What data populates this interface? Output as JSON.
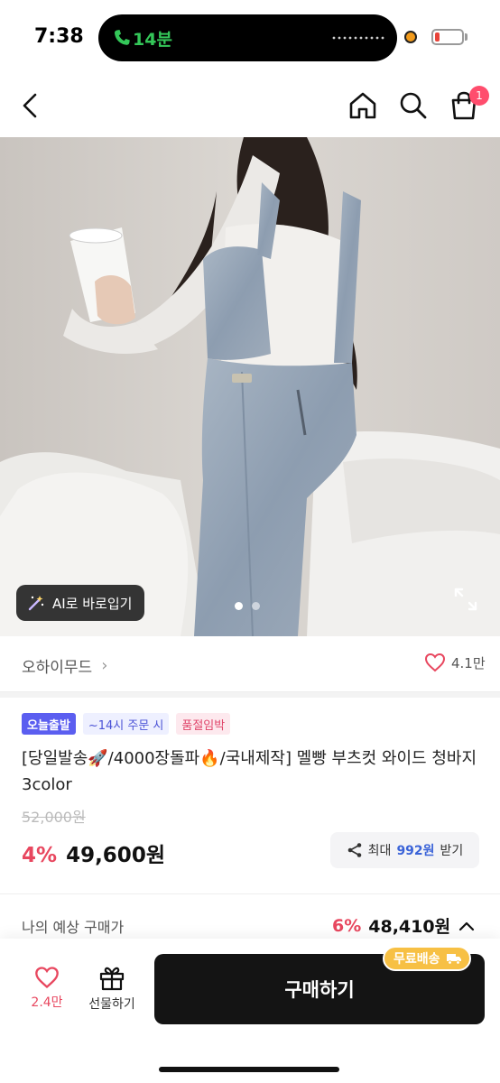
{
  "status_bar": {
    "time": "7:38",
    "call_duration": "14분",
    "icons": [
      "phone-icon",
      "recording-dot-icon",
      "battery-icon"
    ]
  },
  "nav": {
    "icons": [
      "back-icon",
      "home-icon",
      "search-icon",
      "cart-icon"
    ],
    "cart_badge": "1"
  },
  "product_image": {
    "ai_button": "AI로 바로입기",
    "slide_count": 2,
    "active_slide": 1
  },
  "brand": {
    "name": "오하이무드",
    "chevron": "›",
    "likes": "4.1만"
  },
  "badges": {
    "today": "오늘출발",
    "order_by": "~14시 주문 시",
    "soldout": "품절임박"
  },
  "product": {
    "title": "[당일발송🚀/4000장돌파🔥/국내제작] 멜빵 부츠컷 와이드 청바지 3color",
    "original_price": "52,000원",
    "discount": "4%",
    "price": "49,600원"
  },
  "share": {
    "prefix": "최대",
    "points": "992원",
    "suffix": "받기"
  },
  "expected": {
    "label": "나의 예상 구매가",
    "discount": "6%",
    "price": "48,410원"
  },
  "bottom": {
    "like_count": "2.4만",
    "gift_label": "선물하기",
    "buy_label": "구매하기",
    "free_shipping": "무료배송"
  },
  "colors": {
    "accent_red": "#e8475f",
    "badge_blue": "#5b5ef0",
    "points_blue": "#3a63d8",
    "free_ship_yellow": "#f7c044",
    "buy_button": "#141414"
  }
}
